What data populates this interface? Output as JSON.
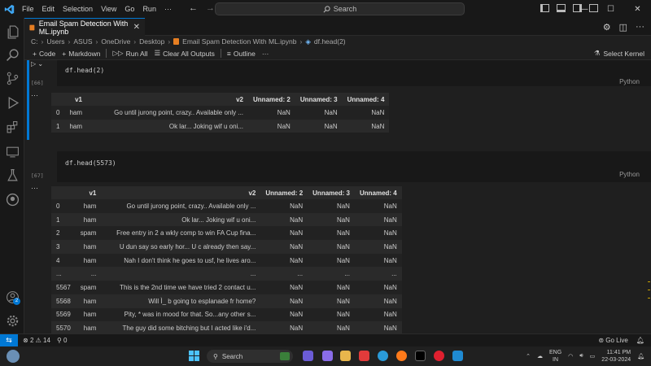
{
  "titlebar": {
    "menu": [
      "File",
      "Edit",
      "Selection",
      "View",
      "Go",
      "Run",
      "···"
    ],
    "search_placeholder": "Search"
  },
  "tab": {
    "label": "Email Spam Detection With ML.ipynb"
  },
  "breadcrumb": [
    "C:",
    "Users",
    "ASUS",
    "OneDrive",
    "Desktop",
    "Email Spam Detection With ML.ipynb",
    "df.head(2)"
  ],
  "toolbar": {
    "code": "Code",
    "markdown": "Markdown",
    "run_all": "Run All",
    "clear_outputs": "Clear All Outputs",
    "outline": "Outline",
    "more": "···",
    "select_kernel": "Select Kernel"
  },
  "cells": [
    {
      "exec": "[66]",
      "code": "df.head(2)",
      "language": "Python",
      "columns": [
        "",
        "v1",
        "v2",
        "Unnamed: 2",
        "Unnamed: 3",
        "Unnamed: 4"
      ],
      "rows": [
        [
          "0",
          "ham",
          "Go until jurong point, crazy.. Available only ...",
          "NaN",
          "NaN",
          "NaN"
        ],
        [
          "1",
          "ham",
          "Ok lar... Joking wif u oni...",
          "NaN",
          "NaN",
          "NaN"
        ]
      ]
    },
    {
      "exec": "[67]",
      "code": "df.head(5573)",
      "language": "Python",
      "columns": [
        "",
        "v1",
        "v2",
        "Unnamed: 2",
        "Unnamed: 3",
        "Unnamed: 4"
      ],
      "rows": [
        [
          "0",
          "ham",
          "Go until jurong point, crazy.. Available only ...",
          "NaN",
          "NaN",
          "NaN"
        ],
        [
          "1",
          "ham",
          "Ok lar... Joking wif u oni...",
          "NaN",
          "NaN",
          "NaN"
        ],
        [
          "2",
          "spam",
          "Free entry in 2 a wkly comp to win FA Cup fina...",
          "NaN",
          "NaN",
          "NaN"
        ],
        [
          "3",
          "ham",
          "U dun say so early hor... U c already then say...",
          "NaN",
          "NaN",
          "NaN"
        ],
        [
          "4",
          "ham",
          "Nah I don't think he goes to usf, he lives aro...",
          "NaN",
          "NaN",
          "NaN"
        ],
        [
          "...",
          "...",
          "...",
          "...",
          "...",
          "..."
        ],
        [
          "5567",
          "spam",
          "This is the 2nd time we have tried 2 contact u...",
          "NaN",
          "NaN",
          "NaN"
        ],
        [
          "5568",
          "ham",
          "Will Ì_ b going to esplanade fr home?",
          "NaN",
          "NaN",
          "NaN"
        ],
        [
          "5569",
          "ham",
          "Pity, * was in mood for that. So...any other s...",
          "NaN",
          "NaN",
          "NaN"
        ],
        [
          "5570",
          "ham",
          "The guy did some bitching but I acted like i'd...",
          "NaN",
          "NaN",
          "NaN"
        ]
      ]
    }
  ],
  "status": {
    "errors": "2",
    "warnings": "14",
    "ports": "0",
    "go_live": "Go Live"
  },
  "taskbar": {
    "search": "Search",
    "lang_top": "ENG",
    "lang_bottom": "IN",
    "time": "11:41 PM",
    "date": "22-03-2024"
  },
  "badges": {
    "accounts": "2"
  },
  "colors": {
    "accent": "#0078d4",
    "background": "#1f1f1f"
  }
}
